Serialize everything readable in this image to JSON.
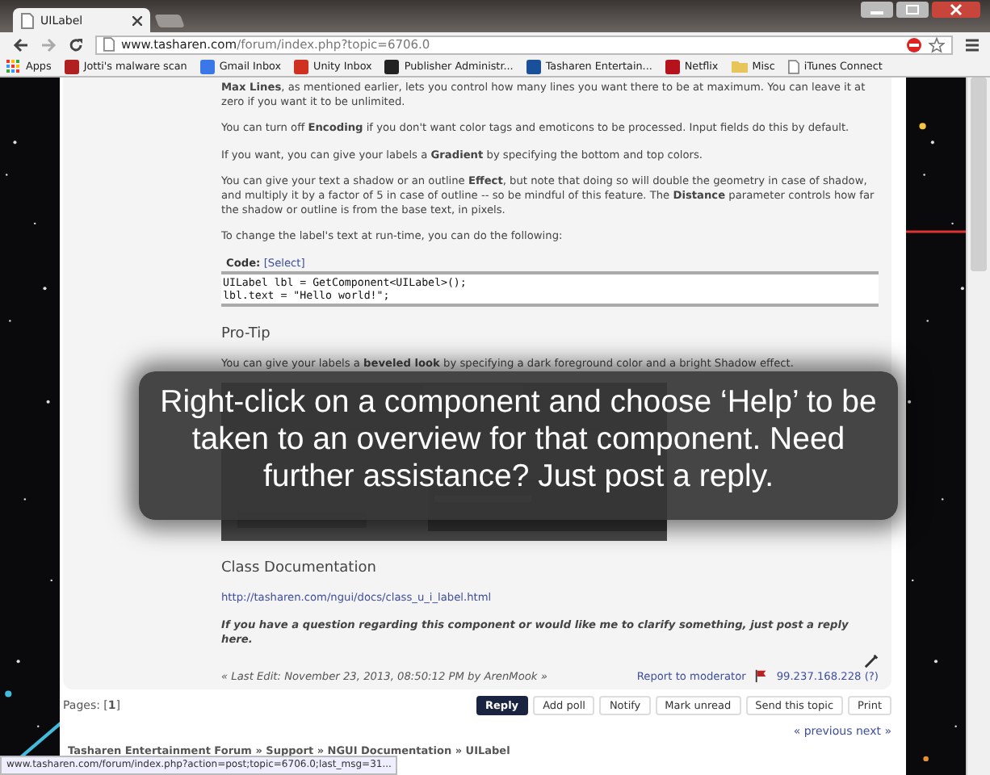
{
  "browser": {
    "tab_title": "UILabel",
    "url_host": "www.tasharen.com",
    "url_path": "/forum/index.php?topic=6706.0",
    "bookmarks": [
      {
        "kind": "apps",
        "label": "Apps"
      },
      {
        "kind": "favicon",
        "label": "Jotti's malware scan",
        "color": "#b02020"
      },
      {
        "kind": "favicon",
        "label": "Gmail Inbox",
        "color": "#3b78e7"
      },
      {
        "kind": "favicon",
        "label": "Unity Inbox",
        "color": "#d03020"
      },
      {
        "kind": "favicon",
        "label": "Publisher Administr...",
        "color": "#222222"
      },
      {
        "kind": "favicon",
        "label": "Tasharen Entertain...",
        "color": "#1a4f9a"
      },
      {
        "kind": "favicon",
        "label": "Netflix",
        "color": "#b5121b"
      },
      {
        "kind": "folder",
        "label": "Misc"
      },
      {
        "kind": "page",
        "label": "iTunes Connect"
      }
    ]
  },
  "post": {
    "paragraphs": [
      "**Max Lines**, as mentioned earlier, lets you control how many lines you want there to be at maximum. You can leave it at zero if you want it to be unlimited.",
      "You can turn off **Encoding** if you don't want color tags and emoticons to be processed. Input fields do this by default.",
      "If you want, you can give your labels a **Gradient** by specifying the bottom and top colors.",
      "You can give your text a shadow or an outline **Effect**, but note that doing so will double the geometry in case of shadow, and multiply it by a factor of 5 in case of outline -- so be mindful of this feature. The **Distance** parameter controls how far the shadow or outline is from the base text, in pixels.",
      "To change the label's text at run-time, you can do the following:"
    ],
    "code": {
      "label": "Code:",
      "select": "[Select]",
      "lines": [
        "UILabel lbl = GetComponent<UILabel>();",
        "lbl.text = \"Hello world!\";"
      ]
    },
    "protip_heading": "Pro-Tip",
    "protip": "You can give your labels a **beveled look** by specifying a dark foreground color and a bright Shadow effect.",
    "image": {
      "kind": "picture"
    },
    "docs_heading": "Class Documentation",
    "docs_link": "http://tasharen.com/ngui/docs/class_u_i_label.html",
    "closing": "If you have a question regarding this component or would like me to clarify something, just post a reply here.",
    "last_edit": "« Last Edit: November 23, 2013, 08:50:12 PM by ArenMook »",
    "report": "Report to moderator",
    "ip": "99.237.168.228 (?)"
  },
  "pages": {
    "label": "Pages: [**1**]"
  },
  "buttons": [
    {
      "label": "Reply",
      "kind": "primary"
    },
    {
      "label": "Add poll",
      "kind": "plain"
    },
    {
      "label": "Notify",
      "kind": "plain"
    },
    {
      "label": "Mark unread",
      "kind": "plain"
    },
    {
      "label": "Send this topic",
      "kind": "plain"
    },
    {
      "label": "Print",
      "kind": "plain"
    }
  ],
  "nav": {
    "previous": "« previous",
    "next": "next »"
  },
  "breadcrumb": "Tasharen Entertainment Forum » Support » NGUI Documentation » UILabel",
  "overlay": "Right-click on a component and choose ‘Help’ to be taken to an overview for that component. Need further assistance? Just post a reply.",
  "status_bar": "www.tasharen.com/forum/index.php?action=post;topic=6706.0;last_msg=31..."
}
